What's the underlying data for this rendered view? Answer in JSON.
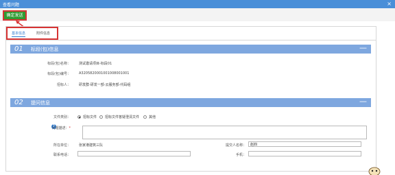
{
  "window": {
    "title": "查看问题",
    "close": "×"
  },
  "toolbar": {
    "confirm_label": "确定发送"
  },
  "tabs": [
    {
      "label": "基本信息"
    },
    {
      "label": "附件信息"
    }
  ],
  "section1": {
    "number": "01",
    "title": "标段(包)信息",
    "collapse": "—",
    "rows": [
      {
        "label": "标段(包)名称：",
        "value": "测试邀请项目-标段01"
      },
      {
        "label": "标段(包)编号：",
        "value": "A3205820001001008001001"
      },
      {
        "label": "招标人：",
        "value": "研发群-研发一部-云服务部-代码组"
      }
    ]
  },
  "section2": {
    "number": "02",
    "title": "提问信息",
    "collapse": "—",
    "file_type_label": "文件类别：",
    "file_type_options": [
      "招标文件",
      "招标文件答疑澄清文件",
      "其他"
    ],
    "question_label": "问题描述：",
    "question_required": "*",
    "question_value": "",
    "unit_label": "所在单位：",
    "unit_value": "张家港建筑三队",
    "submitter_label": "提交人名称：",
    "submitter_value": "赵四",
    "phone_label": "联系电话：",
    "phone_value": "",
    "mobile_label": "手机：",
    "mobile_value": ""
  },
  "colors": {
    "titlebar": "#4a8fd8",
    "section_bar": "#7ea7df",
    "confirm": "#2f9b32",
    "highlight": "#d73333"
  }
}
